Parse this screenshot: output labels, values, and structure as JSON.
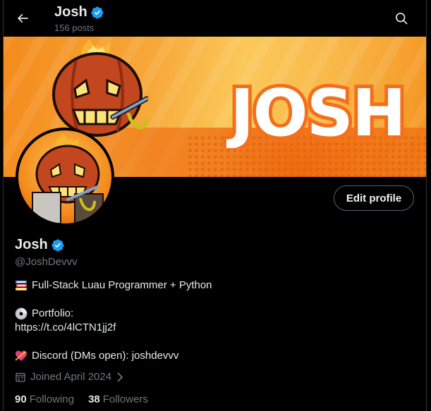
{
  "header": {
    "title": "Josh",
    "post_count": "156 posts",
    "back_icon": "arrow-left-icon",
    "search_icon": "search-icon"
  },
  "banner": {
    "text": "JOSH"
  },
  "actions": {
    "edit_profile": "Edit profile"
  },
  "profile": {
    "name": "Josh",
    "handle": "@JoshDevvv",
    "verified": true,
    "bio": {
      "line1": "Full-Stack Luau Programmer + Python",
      "portfolio_label": "Portfolio:",
      "portfolio_link": "https://t.co/4lCTN1jj2f",
      "discord": "Discord (DMs open): joshdevvv"
    },
    "joined": "Joined April 2024",
    "following_count": "90",
    "following_label": "Following",
    "followers_count": "38",
    "followers_label": "Followers"
  },
  "colors": {
    "background": "#000000",
    "text": "#e7e9ea",
    "muted": "#71767b",
    "verified": "#1d9bf0",
    "border": "#536471"
  }
}
